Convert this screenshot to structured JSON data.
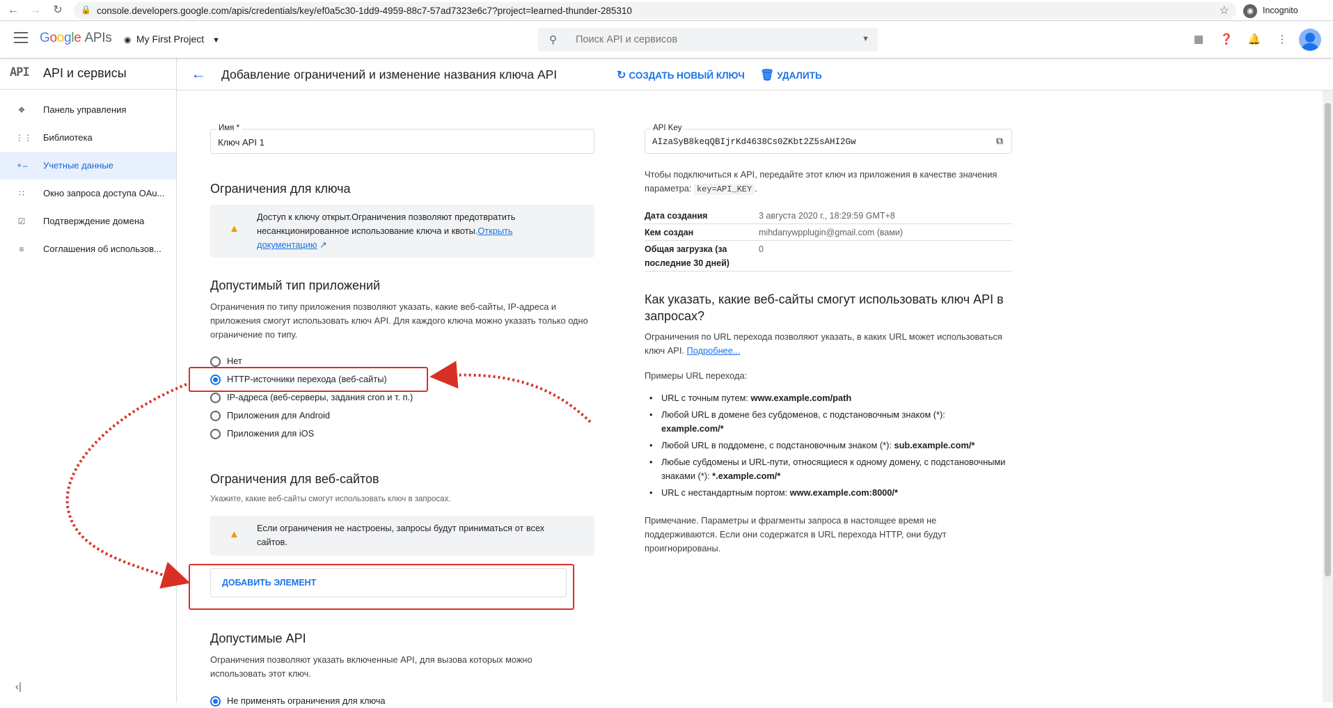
{
  "browser": {
    "url": "console.developers.google.com/apis/credentials/key/ef0a5c30-1dd9-4959-88c7-57ad7323e6c7?project=learned-thunder-285310",
    "incognito_label": "Incognito"
  },
  "topbar": {
    "logo_google": [
      "G",
      "o",
      "o",
      "g",
      "l",
      "e"
    ],
    "logo_apis": "APIs",
    "project": "My First Project",
    "search_placeholder": "Поиск API и сервисов"
  },
  "sidebar": {
    "title": "API и сервисы",
    "items": [
      {
        "label": "Панель управления",
        "icon": "dashboard-icon"
      },
      {
        "label": "Библиотека",
        "icon": "library-icon"
      },
      {
        "label": "Учетные данные",
        "icon": "key-icon",
        "active": true
      },
      {
        "label": "Окно запроса доступа OAu...",
        "icon": "consent-icon"
      },
      {
        "label": "Подтверждение домена",
        "icon": "domain-icon"
      },
      {
        "label": "Соглашения об использов...",
        "icon": "settings-list-icon"
      }
    ]
  },
  "header": {
    "title": "Добавление ограничений и изменение названия ключа API",
    "regenerate_label": "СОЗДАТЬ НОВЫЙ КЛЮЧ",
    "delete_label": "УДАЛИТЬ"
  },
  "form": {
    "name_label": "Имя *",
    "name_value": "Ключ API 1",
    "key_restrictions_title": "Ограничения для ключа",
    "key_warning_text": "Доступ к ключу открыт.Ограничения позволяют предотвратить несанкционированное использование ключа и квоты.",
    "key_warning_link": "Открыть документацию",
    "app_type_title": "Допустимый тип приложений",
    "app_type_desc": "Ограничения по типу приложения позволяют указать, какие веб-сайты, IP-адреса и приложения смогут использовать ключ API. Для каждого ключа можно указать только одно ограничение по типу.",
    "app_type_options": [
      {
        "label": "Нет",
        "selected": false
      },
      {
        "label": "HTTP-источники перехода (веб-сайты)",
        "selected": true
      },
      {
        "label": "IP-адреса (веб-серверы, задания cron и т. п.)",
        "selected": false
      },
      {
        "label": "Приложения для Android",
        "selected": false
      },
      {
        "label": "Приложения для iOS",
        "selected": false
      }
    ],
    "web_restrictions_title": "Ограничения для веб-сайтов",
    "web_restrictions_desc": "Укажите, какие веб-сайты смогут использовать ключ в запросах.",
    "web_warning_text": "Если ограничения не настроены, запросы будут приниматься от всех сайтов.",
    "add_item_label": "ДОБАВИТЬ ЭЛЕМЕНТ",
    "api_restrictions_title": "Допустимые API",
    "api_restrictions_desc": "Ограничения позволяют указать включенные API, для вызова которых можно использовать этот ключ.",
    "api_option_partial": "Не применять ограничения для ключа"
  },
  "panel": {
    "api_key_label": "API Key",
    "api_key_value": "AIzaSyB8keqQBIjrKd4638Cs0ZKbt2Z5sAHI2Gw",
    "connect_text_1": "Чтобы подключиться к API, передайте этот ключ из приложения в качестве значения параметра:",
    "connect_code": "key=API_KEY",
    "connect_text_2": ".",
    "details": [
      {
        "key": "Дата создания",
        "value": "3 августа 2020 г., 18:29:59 GMT+8"
      },
      {
        "key": "Кем создан",
        "value": "mihdanywpplugin@gmail.com (вами)"
      },
      {
        "key": "Общая загрузка (за последние 30 дней)",
        "value": "0"
      }
    ],
    "howto_title": "Как указать, какие веб-сайты смогут использовать ключ API в запросах?",
    "howto_desc": "Ограничения по URL перехода позволяют указать, в каких URL может использоваться ключ API.",
    "howto_link": "Подробнее...",
    "examples_title": "Примеры URL перехода:",
    "examples": [
      {
        "text": "URL с точным путем: ",
        "bold": "www.example.com/path"
      },
      {
        "text": "Любой URL в домене без субдоменов, с подстановочным знаком (*): ",
        "bold": "example.com/*"
      },
      {
        "text": "Любой URL в поддомене, с подстановочным знаком (*): ",
        "bold": "sub.example.com/*"
      },
      {
        "text": "Любые субдомены и URL-пути, относящиеся к одному домену, с подстановочными знаками (*): ",
        "bold": "*.example.com/*"
      },
      {
        "text": "URL с нестандартным портом: ",
        "bold": "www.example.com:8000/*"
      }
    ],
    "note": "Примечание. Параметры и фрагменты запроса в настоящее время не поддерживаются. Если они содержатся в URL перехода HTTP, они будут проигнорированы."
  }
}
